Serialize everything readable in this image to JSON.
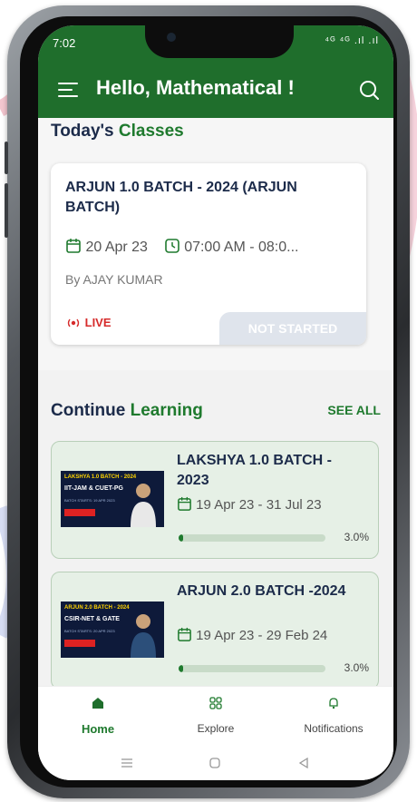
{
  "status": {
    "time": "7:02",
    "icons": "⁴ᴳ ⁴ᴳ .ıl .ıl"
  },
  "header": {
    "greeting": "Hello, Mathematical !"
  },
  "today": {
    "title_part1": "Today's",
    "title_part2": " Classes",
    "card": {
      "title": "ARJUN 1.0  BATCH - 2024 (ARJUN BATCH)",
      "date": "20 Apr 23",
      "time": "07:00 AM - 08:0...",
      "by": "By AJAY KUMAR",
      "live": "LIVE",
      "status": "NOT STARTED"
    }
  },
  "continue": {
    "title_part1": "Continue",
    "title_part2": " Learning",
    "see_all": "SEE ALL",
    "batches": [
      {
        "title": "LAKSHYA 1.0  BATCH - 2023",
        "dates": "19 Apr 23 - 31 Jul 23",
        "progress": 3.0,
        "progress_label": "3.0%",
        "thumb_line1": "LAKSHYA 1.0 BATCH - 2024",
        "thumb_line2": "IIT-JAM & CUET-PG",
        "thumb_line3": "BATCH STARTS: 19 APR 2023"
      },
      {
        "title": "ARJUN 2.0 BATCH -2024",
        "dates": "19 Apr 23 - 29 Feb 24",
        "progress": 3.0,
        "progress_label": "3.0%",
        "thumb_line1": "ARJUN 2.0 BATCH - 2024",
        "thumb_line2": "CSIR-NET & GATE",
        "thumb_line3": "BATCH STARTS: 20 APR 2023"
      }
    ]
  },
  "nav": {
    "home": "Home",
    "explore": "Explore",
    "notifications": "Notifications"
  },
  "colors": {
    "brand": "#1f6e2c",
    "accent": "#1f7a2e",
    "live": "#d62b2b"
  }
}
